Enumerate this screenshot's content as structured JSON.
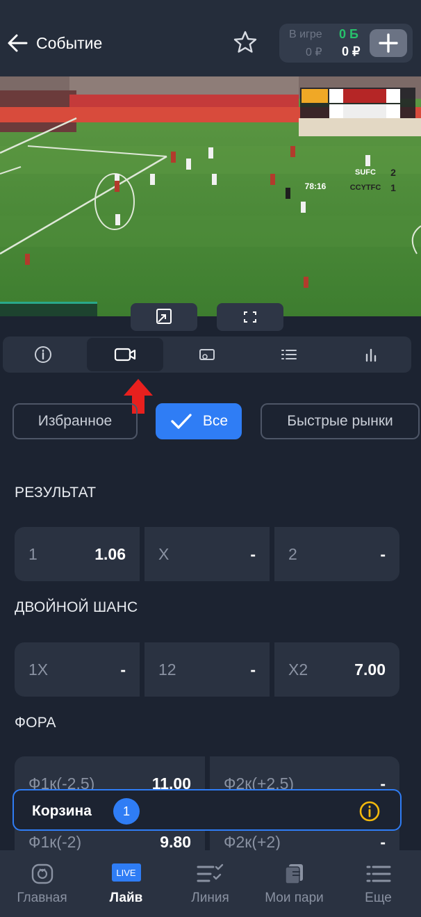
{
  "header": {
    "title": "Событие",
    "balance": {
      "in_game_label": "В игре",
      "in_game_amount": "0 ₽",
      "bonus": "0 Б",
      "money": "0 ₽"
    }
  },
  "scoreboard": {
    "time": "78:16",
    "team1": "SUFC",
    "team2": "CCYTFC",
    "score1": "2",
    "score2": "1"
  },
  "filters": [
    {
      "label": "Избранное"
    },
    {
      "label": "Все"
    },
    {
      "label": "Быстрые рынки"
    }
  ],
  "markets": {
    "result": {
      "title": "РЕЗУЛЬТАТ",
      "odds": [
        {
          "label": "1",
          "value": "1.06"
        },
        {
          "label": "X",
          "value": "-"
        },
        {
          "label": "2",
          "value": "-"
        }
      ]
    },
    "double_chance": {
      "title": "ДВОЙНОЙ ШАНС",
      "odds": [
        {
          "label": "1X",
          "value": "-"
        },
        {
          "label": "12",
          "value": "-"
        },
        {
          "label": "X2",
          "value": "7.00"
        }
      ]
    },
    "handicap": {
      "title": "ФОРА",
      "odds": [
        {
          "label": "Ф1к(-2.5)",
          "value": "11.00"
        },
        {
          "label": "Ф2к(+2.5)",
          "value": "-"
        },
        {
          "label": "Ф1к(-2)",
          "value": "9.80"
        },
        {
          "label": "Ф2к(+2)",
          "value": "-"
        }
      ]
    }
  },
  "basket": {
    "label": "Корзина",
    "count": "1"
  },
  "nav": [
    {
      "label": "Главная"
    },
    {
      "label": "Лайв",
      "badge": "LIVE"
    },
    {
      "label": "Линия"
    },
    {
      "label": "Мои пари"
    },
    {
      "label": "Еще"
    }
  ],
  "colors": {
    "accent": "#2f7df5",
    "background": "#1c2331",
    "card": "#2a3241",
    "bonus": "#27c26b",
    "pointer": "#e8201e"
  }
}
